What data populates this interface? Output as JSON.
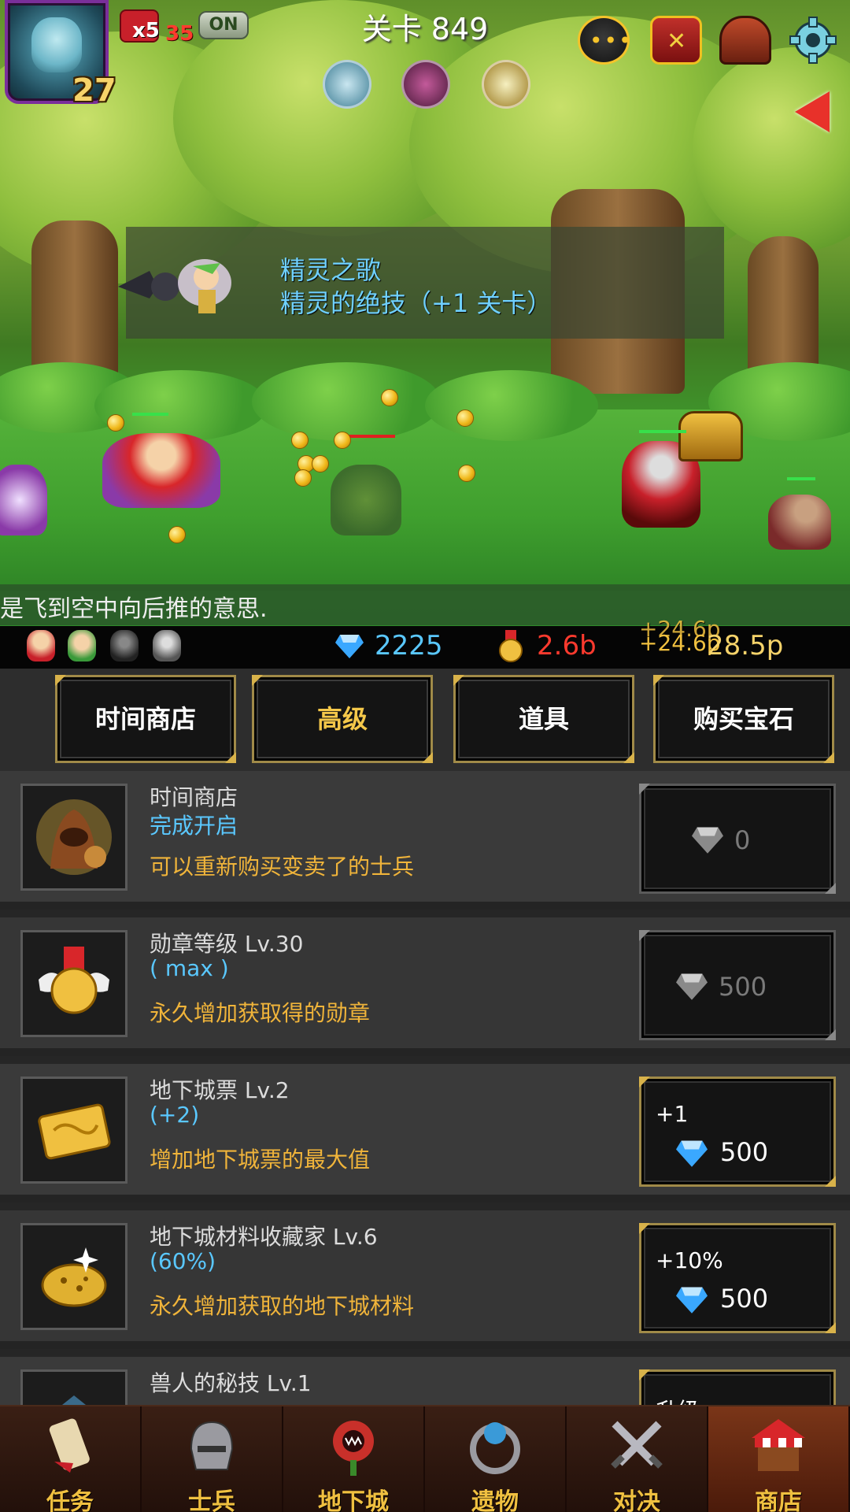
{
  "hud": {
    "player_level": "27",
    "boost_multiplier": "x5",
    "boost_count": "35",
    "auto_toggle": "ON",
    "stage_title": "关卡 849",
    "icons": [
      "chat-icon",
      "castle-icon",
      "house-icon",
      "gear-icon"
    ]
  },
  "banner": {
    "title": "精灵之歌",
    "subtitle": "精灵的绝技（+1 关卡）"
  },
  "marquee": "是飞到空中向后推的意思.",
  "resources": {
    "gems": "2225",
    "medals": "2.6b",
    "gain_a": "+24.6p",
    "gain_b": "+24.6p",
    "gold": "28.5p",
    "colors": {
      "gems": "#5ac8ff",
      "medals": "#ff3a2e",
      "gold": "#f6d36a"
    }
  },
  "shop": {
    "tabs": [
      {
        "label": "时间商店",
        "active": false
      },
      {
        "label": "高级",
        "active": true
      },
      {
        "label": "道具",
        "active": false
      },
      {
        "label": "购买宝石",
        "active": false
      }
    ],
    "items": [
      {
        "name": "时间商店",
        "status": "完成开启",
        "desc": "可以重新购买变卖了的士兵",
        "button_top": "",
        "price": "0",
        "enabled": false,
        "icon": "hooded-merchant-icon"
      },
      {
        "name": "勋章等级 Lv.30",
        "status": "( max )",
        "desc": "永久增加获取得的勋章",
        "button_top": "",
        "price": "500",
        "enabled": false,
        "icon": "winged-medal-icon"
      },
      {
        "name": "地下城票 Lv.2",
        "status": "(+2)",
        "desc": "增加地下城票的最大值",
        "button_top": "+1",
        "price": "500",
        "enabled": true,
        "icon": "golden-ticket-icon"
      },
      {
        "name": "地下城材料收藏家 Lv.6",
        "status": "(60%)",
        "desc": "永久增加获取的地下城材料",
        "button_top": "+10%",
        "price": "500",
        "enabled": true,
        "icon": "gold-ore-icon"
      },
      {
        "name": "兽人的秘技 Lv.1",
        "status": "",
        "desc": "",
        "button_top": "升级",
        "price": "",
        "enabled": true,
        "icon": "orc-bag-icon"
      }
    ],
    "accent": "#f0b43a"
  },
  "nav": [
    {
      "label": "任务",
      "icon": "scroll-icon",
      "active": false
    },
    {
      "label": "士兵",
      "icon": "helmet-icon",
      "active": false
    },
    {
      "label": "地下城",
      "icon": "monster-plant-icon",
      "active": false
    },
    {
      "label": "遗物",
      "icon": "orb-relic-icon",
      "active": false
    },
    {
      "label": "对决",
      "icon": "crossed-swords-icon",
      "active": false
    },
    {
      "label": "商店",
      "icon": "shop-stall-icon",
      "active": true
    }
  ]
}
